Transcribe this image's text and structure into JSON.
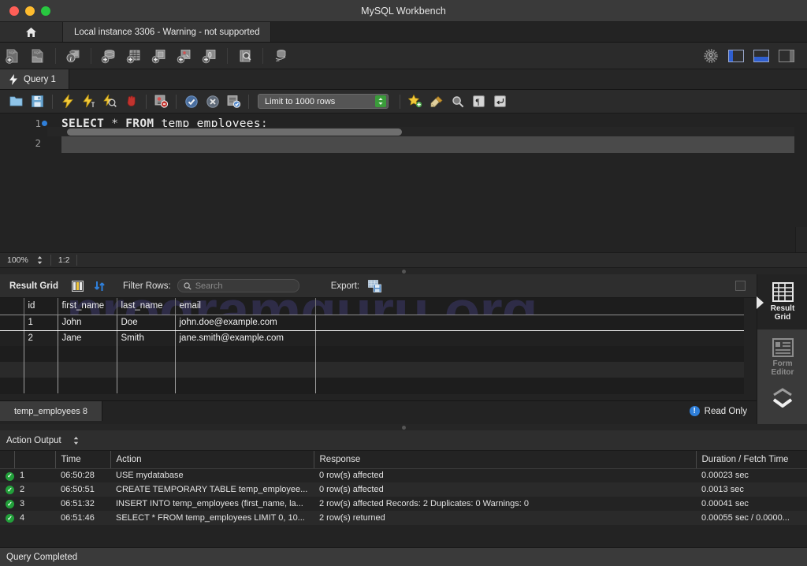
{
  "window": {
    "title": "MySQL Workbench"
  },
  "connection_tabs": {
    "home_icon": "home-icon",
    "active_tab": "Local instance 3306 - Warning - not supported"
  },
  "main_toolbar": {
    "buttons": [
      {
        "name": "new-sql-tab-icon",
        "label": "New SQL Tab"
      },
      {
        "name": "open-sql-script-icon",
        "label": "Open SQL Script"
      },
      {
        "name": "inspector-icon",
        "label": "Schema Inspector"
      },
      {
        "name": "create-schema-icon",
        "label": "Create New Schema"
      },
      {
        "name": "create-table-icon",
        "label": "Create New Table"
      },
      {
        "name": "create-view-icon",
        "label": "Create New View"
      },
      {
        "name": "create-procedure-icon",
        "label": "Create New Stored Procedure"
      },
      {
        "name": "create-function-icon",
        "label": "Create New Function"
      },
      {
        "name": "search-data-icon",
        "label": "Search Table Data"
      },
      {
        "name": "reconnect-dbms-icon",
        "label": "Reconnect to DBMS"
      }
    ],
    "right_buttons": [
      {
        "name": "settings-gear-icon",
        "label": "Settings"
      },
      {
        "name": "toggle-sidebar-icon",
        "label": "Toggle Sidebar"
      },
      {
        "name": "toggle-output-icon",
        "label": "Toggle Output Area"
      },
      {
        "name": "toggle-secondary-sidebar-icon",
        "label": "Toggle Secondary Sidebar"
      }
    ]
  },
  "query_tabs": {
    "active": "Query 1",
    "icon": "lightning-icon"
  },
  "query_toolbar": {
    "buttons": [
      {
        "name": "open-file-icon",
        "label": "Open a script file in this editor"
      },
      {
        "name": "save-file-icon",
        "label": "Save the script to a file"
      },
      {
        "name": "execute-icon",
        "label": "Execute the selected portion of the script"
      },
      {
        "name": "execute-current-icon",
        "label": "Execute the statement under the keyboard cursor"
      },
      {
        "name": "explain-icon",
        "label": "Execute Explain for the statement under the cursor"
      },
      {
        "name": "stop-icon",
        "label": "Stop the query being executed"
      },
      {
        "name": "toggle-stop-on-error-icon",
        "label": "Toggle whether execution should stop on errors"
      },
      {
        "name": "commit-icon",
        "label": "Commit"
      },
      {
        "name": "rollback-icon",
        "label": "Rollback"
      },
      {
        "name": "autocommit-icon",
        "label": "Toggle Auto-Commit mode"
      }
    ],
    "limit_value": "Limit to 1000 rows",
    "right_buttons": [
      {
        "name": "save-snippet-icon",
        "label": "Save current statement to the snippet list"
      },
      {
        "name": "beautify-icon",
        "label": "Beautify/reformat the SQL script"
      },
      {
        "name": "find-icon",
        "label": "Show the Find panel"
      },
      {
        "name": "invisible-chars-icon",
        "label": "Toggle invisible characters"
      },
      {
        "name": "wrap-lines-icon",
        "label": "Toggle wrapping of long lines"
      }
    ]
  },
  "editor": {
    "lines": [
      {
        "number": "1",
        "breakpoint": true,
        "tokens": [
          {
            "t": "SELECT",
            "c": "kw"
          },
          {
            "t": " ",
            "c": "op"
          },
          {
            "t": "*",
            "c": "op"
          },
          {
            "t": " ",
            "c": "op"
          },
          {
            "t": "FROM",
            "c": "kw"
          },
          {
            "t": " ",
            "c": "op"
          },
          {
            "t": "temp_employees",
            "c": "ident"
          },
          {
            "t": ";",
            "c": "op"
          }
        ]
      },
      {
        "number": "2",
        "breakpoint": false,
        "tokens": []
      }
    ],
    "zoom": "100%",
    "cursor_position": "1:2"
  },
  "result_grid": {
    "title": "Result Grid",
    "filter_label": "Filter Rows:",
    "search_placeholder": "Search",
    "export_label": "Export:",
    "icons": {
      "grid_view": "grid-columns-icon",
      "refresh": "refresh-arrows-icon",
      "search": "magnifier-icon",
      "export": "export-recordset-icon"
    },
    "columns": [
      "id",
      "first_name",
      "last_name",
      "email"
    ],
    "rows": [
      {
        "id": "1",
        "first_name": "John",
        "last_name": "Doe",
        "email": "john.doe@example.com"
      },
      {
        "id": "2",
        "first_name": "Jane",
        "last_name": "Smith",
        "email": "jane.smith@example.com"
      }
    ],
    "watermark": "programguru.org",
    "tab_label": "temp_employees 8",
    "read_only_label": "Read Only",
    "side_panel": [
      {
        "name": "result-grid",
        "label": "Result\nGrid",
        "line1": "Result",
        "line2": "Grid",
        "active": true
      },
      {
        "name": "form-editor",
        "label": "Form Editor",
        "line1": "Form",
        "line2": "Editor",
        "active": false
      }
    ]
  },
  "action_output": {
    "title": "Action Output",
    "columns": [
      "",
      "",
      "Time",
      "Action",
      "Response",
      "Duration / Fetch Time"
    ],
    "rows": [
      {
        "status": "ok",
        "num": "1",
        "time": "06:50:28",
        "action": "USE mydatabase",
        "response": "0 row(s) affected",
        "duration": "0.00023 sec"
      },
      {
        "status": "ok",
        "num": "2",
        "time": "06:50:51",
        "action": "CREATE TEMPORARY TABLE temp_employee...",
        "response": "0 row(s) affected",
        "duration": "0.0013 sec"
      },
      {
        "status": "ok",
        "num": "3",
        "time": "06:51:32",
        "action": "INSERT INTO temp_employees (first_name, la...",
        "response": "2 row(s) affected Records: 2  Duplicates: 0  Warnings: 0",
        "duration": "0.00041 sec"
      },
      {
        "status": "ok",
        "num": "4",
        "time": "06:51:46",
        "action": "SELECT * FROM temp_employees LIMIT 0, 10...",
        "response": "2 row(s) returned",
        "duration": "0.00055 sec / 0.0000..."
      }
    ]
  },
  "status_bar": {
    "message": "Query Completed"
  },
  "colors": {
    "accent_blue": "#2f7fd9",
    "success_green": "#22a03a",
    "watermark": "#2e2c47",
    "titlebar": "#3a3a3a"
  }
}
